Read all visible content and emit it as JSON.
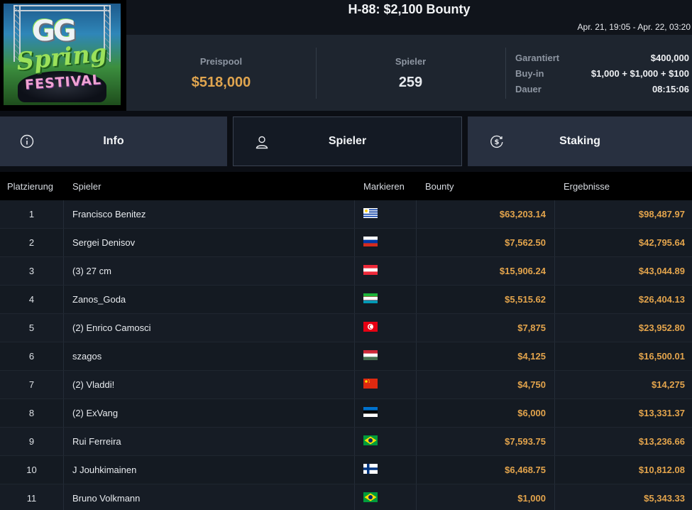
{
  "logo": {
    "gg": "GG",
    "spring": "Spring",
    "festival": "FESTIVAL"
  },
  "header": {
    "title": "H-88: $2,100 Bounty",
    "date_range": "Apr. 21, 19:05 - Apr. 22, 03:20"
  },
  "stats": {
    "prizepool_label": "Preispool",
    "prizepool_value": "$518,000",
    "players_label": "Spieler",
    "players_value": "259",
    "details": [
      {
        "label": "Garantiert",
        "value": "$400,000"
      },
      {
        "label": "Buy-in",
        "value": "$1,000 + $1,000 + $100"
      },
      {
        "label": "Dauer",
        "value": "08:15:06"
      }
    ]
  },
  "tabs": [
    {
      "label": "Info",
      "icon": "info-icon",
      "active": false
    },
    {
      "label": "Spieler",
      "icon": "user-icon",
      "active": true
    },
    {
      "label": "Staking",
      "icon": "dollar-cycle-icon",
      "active": false
    }
  ],
  "table": {
    "headers": {
      "rank": "Platzierung",
      "player": "Spieler",
      "mark": "Markieren",
      "bounty": "Bounty",
      "results": "Ergebnisse"
    },
    "rows": [
      {
        "rank": "1",
        "name": "Francisco Benitez",
        "flag": "uruguay",
        "bounty": "$63,203.14",
        "result": "$98,487.97"
      },
      {
        "rank": "2",
        "name": "Sergei Denisov",
        "flag": "russia",
        "bounty": "$7,562.50",
        "result": "$42,795.64"
      },
      {
        "rank": "3",
        "name": "(3) 27 cm",
        "flag": "austria",
        "bounty": "$15,906.24",
        "result": "$43,044.89"
      },
      {
        "rank": "4",
        "name": "Zanos_Goda",
        "flag": "uzbekistan",
        "bounty": "$5,515.62",
        "result": "$26,404.13"
      },
      {
        "rank": "5",
        "name": "(2) Enrico Camosci",
        "flag": "tunisia",
        "bounty": "$7,875",
        "result": "$23,952.80"
      },
      {
        "rank": "6",
        "name": "szagos",
        "flag": "hungary",
        "bounty": "$4,125",
        "result": "$16,500.01"
      },
      {
        "rank": "7",
        "name": "(2) Vladdi!",
        "flag": "china",
        "bounty": "$4,750",
        "result": "$14,275"
      },
      {
        "rank": "8",
        "name": "(2) ExVang",
        "flag": "estonia",
        "bounty": "$6,000",
        "result": "$13,331.37"
      },
      {
        "rank": "9",
        "name": "Rui Ferreira",
        "flag": "brazil",
        "bounty": "$7,593.75",
        "result": "$13,236.66"
      },
      {
        "rank": "10",
        "name": "J Jouhkimainen",
        "flag": "finland",
        "bounty": "$6,468.75",
        "result": "$10,812.08"
      },
      {
        "rank": "11",
        "name": "Bruno Volkmann",
        "flag": "brazil",
        "bounty": "$1,000",
        "result": "$5,343.33"
      }
    ]
  },
  "colors": {
    "accent_gold": "#e3a44c",
    "panel": "#1e252f",
    "tab": "#283040",
    "tab_active": "#141a24"
  }
}
